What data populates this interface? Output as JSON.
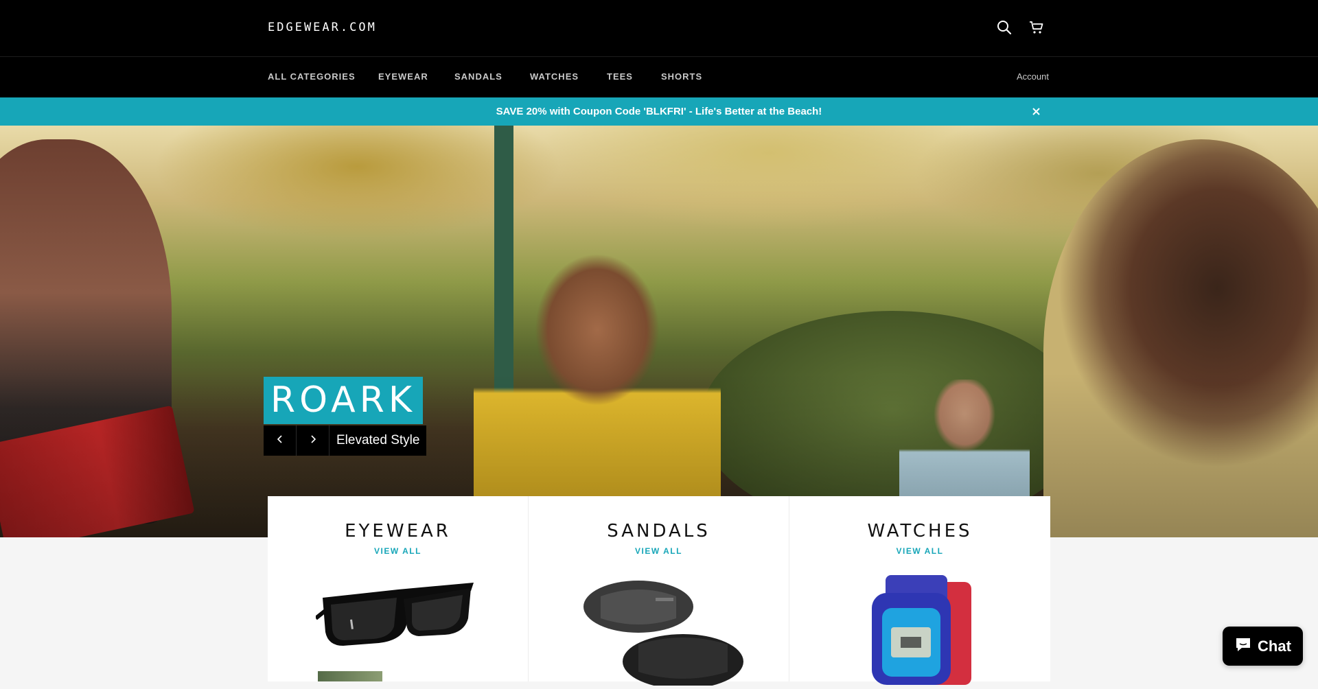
{
  "header": {
    "logo": "EDGEWEAR.COM",
    "search_icon": "search-icon",
    "cart_icon": "cart-icon"
  },
  "nav": {
    "items": [
      {
        "label": "ALL CATEGORIES"
      },
      {
        "label": "EYEWEAR"
      },
      {
        "label": "SANDALS"
      },
      {
        "label": "WATCHES"
      },
      {
        "label": "TEES"
      },
      {
        "label": "SHORTS"
      }
    ],
    "account": "Account"
  },
  "announcement": {
    "text": "SAVE 20% with Coupon Code 'BLKFRI' - Life's Better at the Beach!",
    "close_icon": "close-icon"
  },
  "hero": {
    "title": "ROARK",
    "subtitle": "Elevated Style",
    "prev_icon": "chevron-left-icon",
    "next_icon": "chevron-right-icon"
  },
  "collections": [
    {
      "title": "EYEWEAR",
      "link": "VIEW ALL",
      "image": "sunglasses"
    },
    {
      "title": "SANDALS",
      "link": "VIEW ALL",
      "image": "slide-sandals"
    },
    {
      "title": "WATCHES",
      "link": "VIEW ALL",
      "image": "digital-watch"
    }
  ],
  "chat": {
    "label": "Chat",
    "icon": "chat-bubble-icon"
  },
  "colors": {
    "accent": "#17a6b8",
    "header_bg": "#000000",
    "page_bg": "#f5f5f5"
  }
}
